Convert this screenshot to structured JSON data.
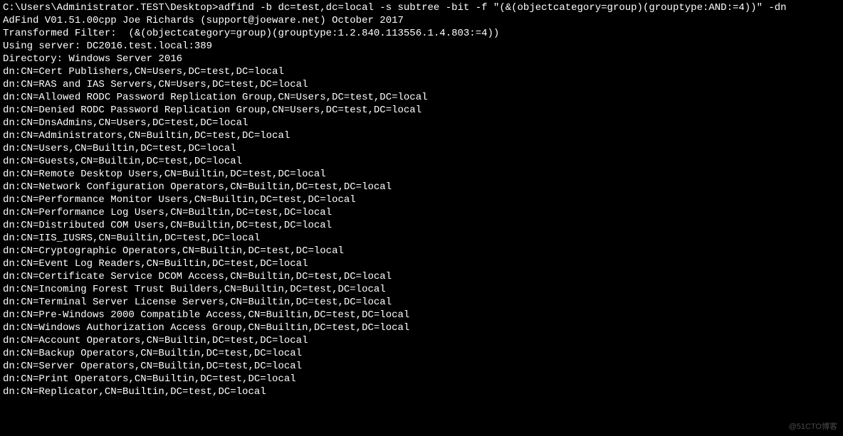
{
  "prompt": "C:\\Users\\Administrator.TEST\\Desktop>",
  "command": "adfind -b dc=test,dc=local -s subtree -bit -f \"(&(objectcategory=group)(grouptype:AND:=4))\" -dn",
  "blank1": "",
  "banner": "AdFind V01.51.00cpp Joe Richards (support@joeware.net) October 2017",
  "blank2": "",
  "filter": "Transformed Filter:  (&(objectcategory=group)(grouptype:1.2.840.113556.1.4.803:=4))",
  "server": "Using server: DC2016.test.local:389",
  "directory": "Directory: Windows Server 2016",
  "blank3": "",
  "dn_entries": [
    "dn:CN=Cert Publishers,CN=Users,DC=test,DC=local",
    "dn:CN=RAS and IAS Servers,CN=Users,DC=test,DC=local",
    "dn:CN=Allowed RODC Password Replication Group,CN=Users,DC=test,DC=local",
    "dn:CN=Denied RODC Password Replication Group,CN=Users,DC=test,DC=local",
    "dn:CN=DnsAdmins,CN=Users,DC=test,DC=local",
    "dn:CN=Administrators,CN=Builtin,DC=test,DC=local",
    "dn:CN=Users,CN=Builtin,DC=test,DC=local",
    "dn:CN=Guests,CN=Builtin,DC=test,DC=local",
    "dn:CN=Remote Desktop Users,CN=Builtin,DC=test,DC=local",
    "dn:CN=Network Configuration Operators,CN=Builtin,DC=test,DC=local",
    "dn:CN=Performance Monitor Users,CN=Builtin,DC=test,DC=local",
    "dn:CN=Performance Log Users,CN=Builtin,DC=test,DC=local",
    "dn:CN=Distributed COM Users,CN=Builtin,DC=test,DC=local",
    "dn:CN=IIS_IUSRS,CN=Builtin,DC=test,DC=local",
    "dn:CN=Cryptographic Operators,CN=Builtin,DC=test,DC=local",
    "dn:CN=Event Log Readers,CN=Builtin,DC=test,DC=local",
    "dn:CN=Certificate Service DCOM Access,CN=Builtin,DC=test,DC=local",
    "dn:CN=Incoming Forest Trust Builders,CN=Builtin,DC=test,DC=local",
    "dn:CN=Terminal Server License Servers,CN=Builtin,DC=test,DC=local",
    "dn:CN=Pre-Windows 2000 Compatible Access,CN=Builtin,DC=test,DC=local",
    "dn:CN=Windows Authorization Access Group,CN=Builtin,DC=test,DC=local",
    "dn:CN=Account Operators,CN=Builtin,DC=test,DC=local",
    "dn:CN=Backup Operators,CN=Builtin,DC=test,DC=local",
    "dn:CN=Server Operators,CN=Builtin,DC=test,DC=local",
    "dn:CN=Print Operators,CN=Builtin,DC=test,DC=local",
    "dn:CN=Replicator,CN=Builtin,DC=test,DC=local"
  ],
  "watermark": "@51CTO博客"
}
